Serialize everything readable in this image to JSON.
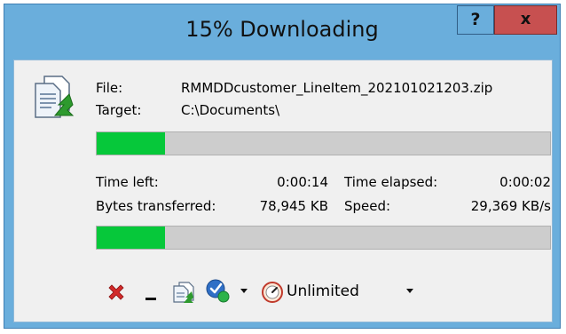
{
  "window": {
    "title": "15% Downloading",
    "help_label": "?",
    "close_label": "x"
  },
  "file": {
    "file_label": "File:",
    "file_value": "RMMDDcustomer_LineItem_202101021203.zip",
    "target_label": "Target:",
    "target_value": "C:\\Documents\\"
  },
  "progress": {
    "file_fraction": 0.15,
    "total_fraction": 0.15
  },
  "stats": {
    "time_left_label": "Time left:",
    "time_left_value": "0:00:14",
    "time_elapsed_label": "Time elapsed:",
    "time_elapsed_value": "0:00:02",
    "bytes_label": "Bytes transferred:",
    "bytes_value": "78,945 KB",
    "speed_label": "Speed:",
    "speed_value": "29,369 KB/s"
  },
  "toolbar": {
    "speed_limit_value": "Unlimited"
  },
  "colors": {
    "progress_fill": "#06c83a",
    "cancel_red": "#d22a2a",
    "title_bg": "#6aaedc",
    "close_bg": "#c75050"
  },
  "icons": [
    "file-transfer-icon",
    "cancel-icon",
    "minimize-icon",
    "copy-files-icon",
    "check-options-icon",
    "speed-gauge-icon"
  ]
}
